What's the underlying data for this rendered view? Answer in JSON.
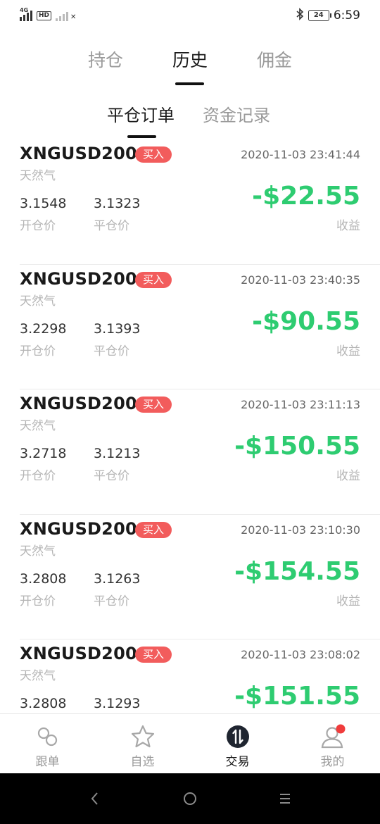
{
  "status_bar": {
    "network_type": "4G",
    "hd_label": "HD",
    "battery_level": "24",
    "time": "6:59",
    "icons": [
      "signal-icon",
      "hd-icon",
      "signal-weak-icon",
      "bluetooth-icon",
      "battery-icon"
    ]
  },
  "top_tabs": [
    {
      "label": "持仓",
      "active": false
    },
    {
      "label": "历史",
      "active": true
    },
    {
      "label": "佣金",
      "active": false
    }
  ],
  "sub_tabs": [
    {
      "label": "平仓订单",
      "active": true
    },
    {
      "label": "资金记录",
      "active": false
    }
  ],
  "labels": {
    "open_price": "开仓价",
    "close_price": "平仓价",
    "profit": "收益"
  },
  "orders": [
    {
      "symbol": "XNGUSD200",
      "side": "买入",
      "time": "2020-11-03 23:41:44",
      "product": "天然气",
      "open_price": "3.1548",
      "close_price": "3.1323",
      "pnl": "-$22.55"
    },
    {
      "symbol": "XNGUSD200",
      "side": "买入",
      "time": "2020-11-03 23:40:35",
      "product": "天然气",
      "open_price": "3.2298",
      "close_price": "3.1393",
      "pnl": "-$90.55"
    },
    {
      "symbol": "XNGUSD200",
      "side": "买入",
      "time": "2020-11-03 23:11:13",
      "product": "天然气",
      "open_price": "3.2718",
      "close_price": "3.1213",
      "pnl": "-$150.55"
    },
    {
      "symbol": "XNGUSD200",
      "side": "买入",
      "time": "2020-11-03 23:10:30",
      "product": "天然气",
      "open_price": "3.2808",
      "close_price": "3.1263",
      "pnl": "-$154.55"
    },
    {
      "symbol": "XNGUSD200",
      "side": "买入",
      "time": "2020-11-03 23:08:02",
      "product": "天然气",
      "open_price": "3.2808",
      "close_price": "3.1293",
      "pnl": "-$151.55"
    }
  ],
  "bottom_nav": [
    {
      "label": "跟单",
      "icon": "link-icon",
      "active": false
    },
    {
      "label": "自选",
      "icon": "star-icon",
      "active": false
    },
    {
      "label": "交易",
      "icon": "trade-icon",
      "active": true
    },
    {
      "label": "我的",
      "icon": "profile-icon",
      "active": false,
      "notification_dot": true
    }
  ],
  "colors": {
    "profit_text": "#2ecc71",
    "buy_badge": "#f25c5c",
    "inactive_text": "#9a9a9a",
    "notification_dot": "#f03c3c"
  },
  "system_nav": [
    "back-icon",
    "home-icon",
    "menu-icon"
  ]
}
